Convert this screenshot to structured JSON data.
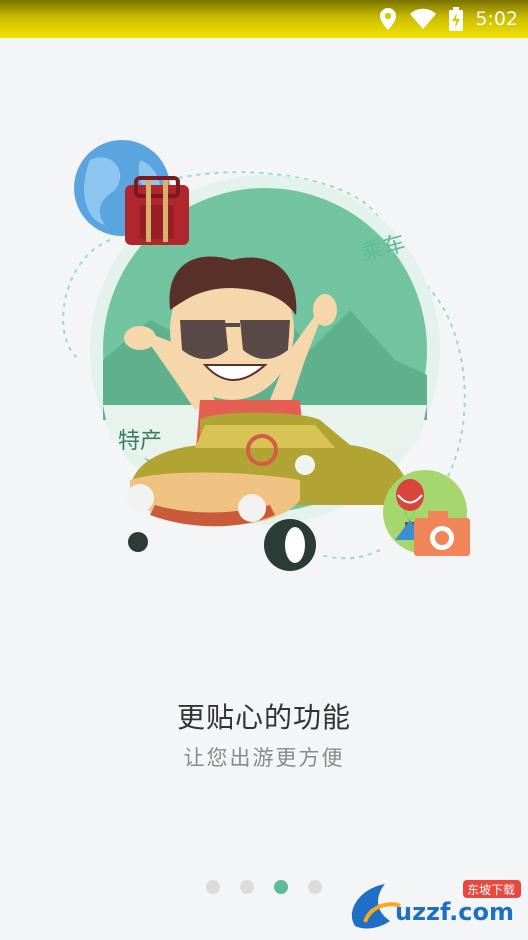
{
  "status_bar": {
    "time": "5:02",
    "icons": [
      "location-icon",
      "wifi-icon",
      "battery-charging-icon"
    ]
  },
  "illustration": {
    "label_ride": "乘车",
    "label_specialty": "特产"
  },
  "onboarding": {
    "title": "更贴心的功能",
    "subtitle": "让您出游更方便"
  },
  "pager": {
    "count": 4,
    "active_index": 2
  },
  "watermark": {
    "brand": "uzzf.com",
    "tag": "东坡下载"
  },
  "colors": {
    "status_bar": "#f3e400",
    "accent_green": "#5dbb95",
    "title": "#333333",
    "subtitle": "#8a8a8a"
  }
}
